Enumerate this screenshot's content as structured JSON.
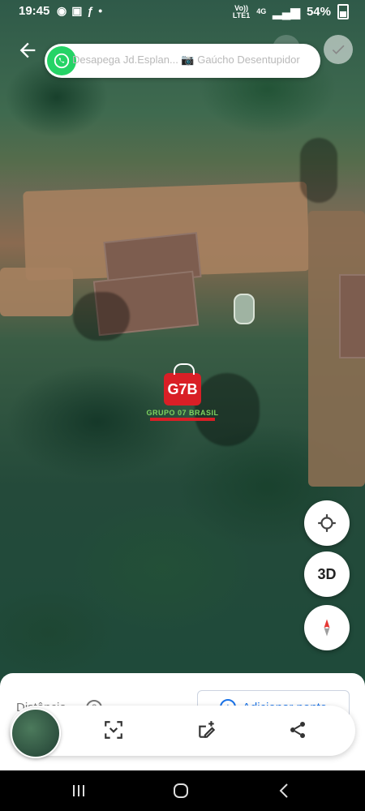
{
  "status": {
    "time": "19:45",
    "network_top": "Vo))",
    "network_bottom": "LTE1",
    "network_type": "4G",
    "battery": "54%",
    "notification_icons": [
      "whatsapp-icon",
      "image-icon",
      "facebook-icon",
      "dot-icon"
    ]
  },
  "notification": {
    "app": "WhatsApp",
    "text": "Desapega Jd.Esplan... 📷 Gaúcho Desentupidor"
  },
  "map": {
    "logo_name": "GRUPO 07 BRASIL",
    "logo_mark": "G7B"
  },
  "controls": {
    "three_d": "3D"
  },
  "panel": {
    "distance_label": "Distância",
    "add_point_label": "Adicionar ponto"
  },
  "toolbar": {
    "icons": [
      "screenshot-icon",
      "add-note-icon",
      "share-icon"
    ]
  },
  "colors": {
    "accent": "#1a73e8",
    "whatsapp": "#25d366",
    "compass_red": "#e53935"
  }
}
